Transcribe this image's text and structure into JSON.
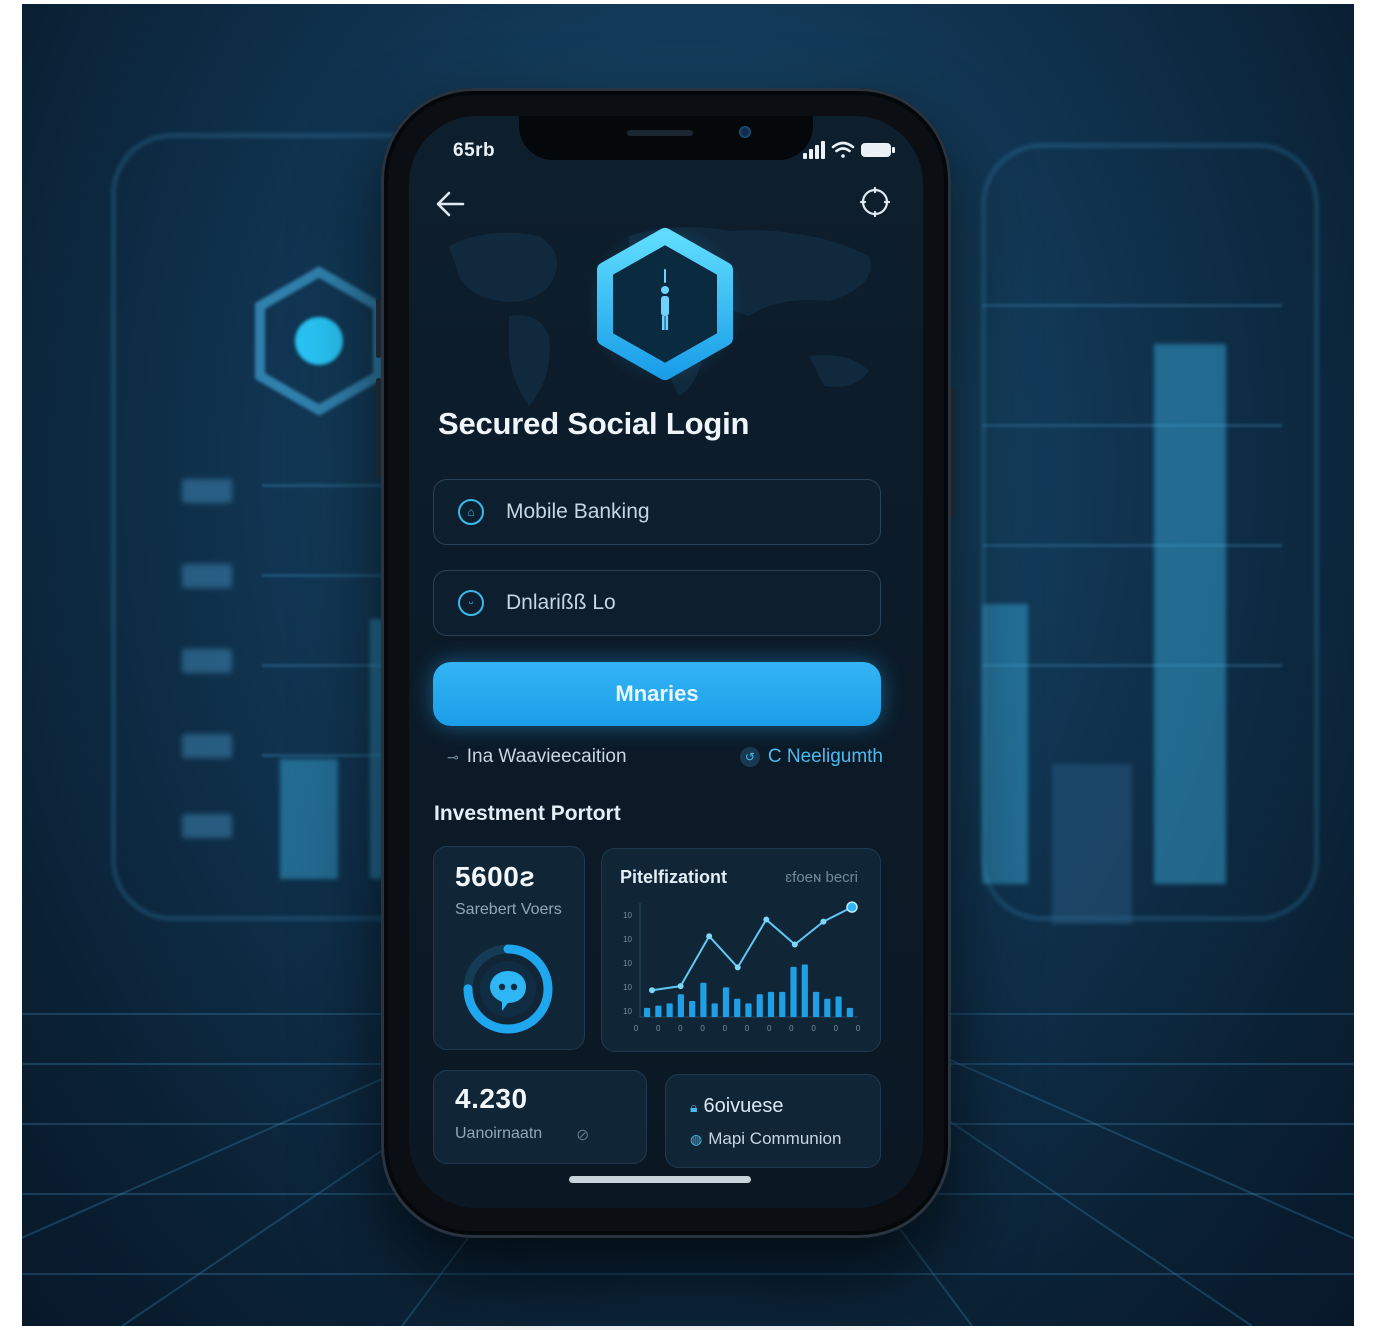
{
  "status_bar": {
    "time": "65rb"
  },
  "header": {
    "back_icon": "arrow-left-icon",
    "settings_icon": "target-icon"
  },
  "hero": {
    "logo_icon": "hexagon-shield-icon"
  },
  "title": "Secured Social Login",
  "fields": [
    {
      "label": "Mobile Banking",
      "icon": "bank-icon",
      "icon_glyph": "⌂"
    },
    {
      "label": "Dnlarißß Lo",
      "icon": "lock-icon",
      "icon_glyph": "ᵕ"
    }
  ],
  "primary_button": {
    "label": "Mnaries"
  },
  "links": {
    "left": {
      "text": "Ina Waavieecaition",
      "icon": "key-icon",
      "glyph": "⊸"
    },
    "right": {
      "text": "C Neeligumth",
      "icon": "refresh-icon",
      "glyph": "↺"
    }
  },
  "portfolio": {
    "section_title": "Investment Portort",
    "card_a": {
      "value": "5600ƨ",
      "label": "Sarebert Voers",
      "ring_icon": "chat-bubble-icon",
      "ring_progress": 0.75
    },
    "card_b": {
      "title": "Pitelfizationt",
      "subtitle": "ɛfoeɴ becri",
      "chart_data": {
        "type": "line",
        "x_tick_labels": [
          "0",
          "0",
          "0",
          "0",
          "0",
          "0",
          "0",
          "0",
          "0",
          "0",
          "0"
        ],
        "y_tick_labels": [
          "10",
          "10",
          "10",
          "10",
          "10"
        ],
        "line_series": [
          18,
          22,
          70,
          40,
          86,
          62,
          84,
          98
        ],
        "bar_values": [
          8,
          10,
          12,
          20,
          14,
          30,
          12,
          26,
          16,
          12,
          20,
          22,
          22,
          44,
          46,
          22,
          16,
          18,
          8
        ],
        "highlight_last_point": true
      }
    },
    "card_c": {
      "value": "4.230",
      "label": "Uanoirnaatn",
      "icon": "tag-icon",
      "glyph": "⊘"
    },
    "card_d": {
      "title": "6oivuese",
      "title_icon": "lock-icon",
      "title_glyph": "🔒︎",
      "line2": "Mapi Communion",
      "line2_icon": "globe-icon",
      "line2_glyph": "◍"
    }
  },
  "colors": {
    "accent": "#1ea6ee",
    "background": "#0c1b29",
    "card": "#11273a",
    "text": "#eef5fb"
  }
}
